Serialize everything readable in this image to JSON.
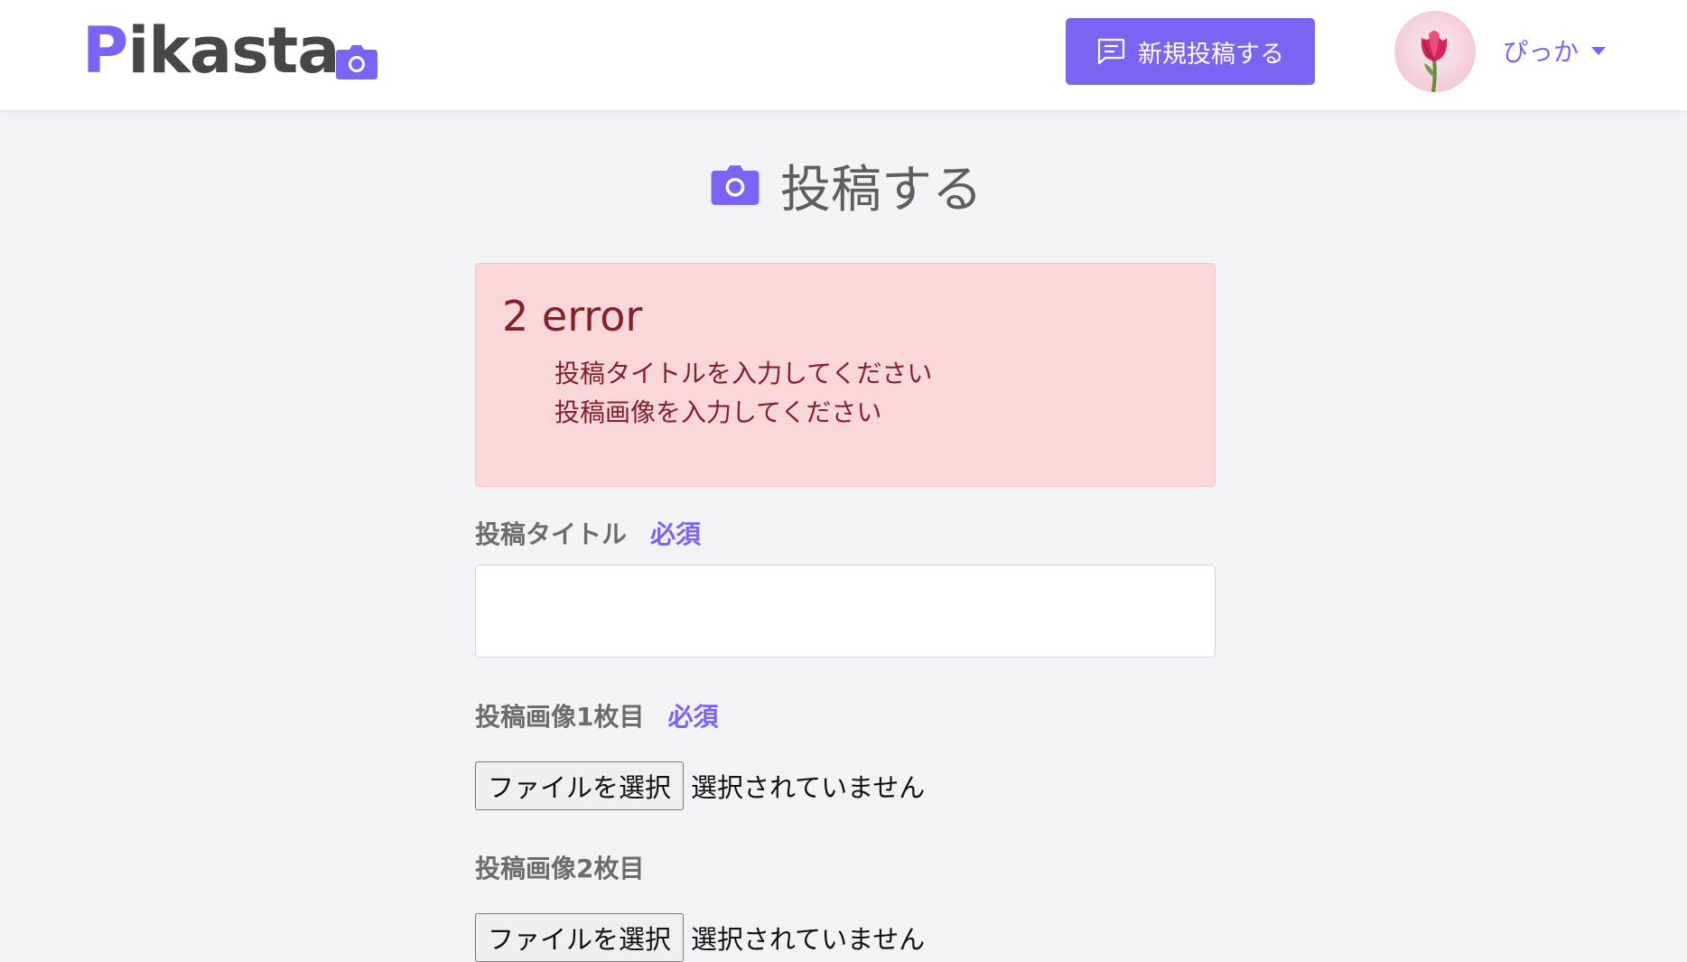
{
  "brand": {
    "name_first": "P",
    "name_rest": "ikasta",
    "accent": "#7b63f3"
  },
  "header": {
    "new_post_label": "新規投稿する",
    "username": "ぴっか"
  },
  "page": {
    "title": "投稿する"
  },
  "errors": {
    "heading": "2 error",
    "items": [
      "投稿タイトルを入力してください",
      "投稿画像を入力してください"
    ],
    "colors": {
      "background": "#f8d7da",
      "text": "#842029"
    }
  },
  "form": {
    "title_field": {
      "label": "投稿タイトル",
      "required": "必須",
      "value": ""
    },
    "image1": {
      "label": "投稿画像1枚目",
      "required": "必須",
      "button": "ファイルを選択",
      "status": "選択されていません"
    },
    "image2": {
      "label": "投稿画像2枚目",
      "button": "ファイルを選択",
      "status": "選択されていません"
    }
  }
}
